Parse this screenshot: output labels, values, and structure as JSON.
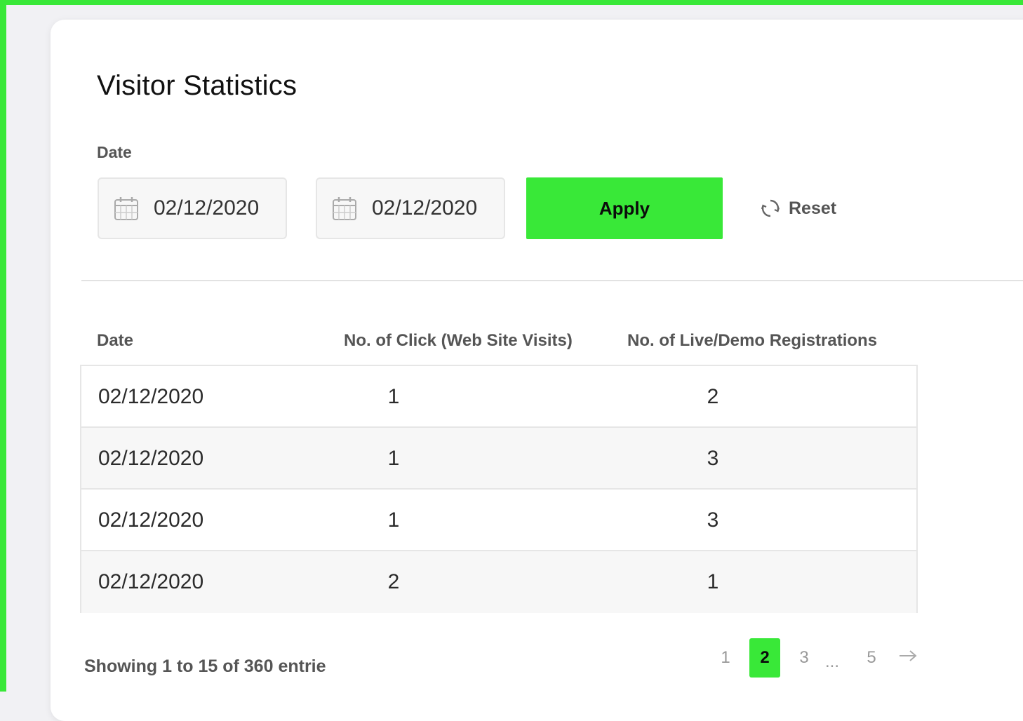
{
  "colors": {
    "accent": "#39e838",
    "frame": "#39e838",
    "text_muted": "#555555"
  },
  "page": {
    "title": "Visitor Statistics"
  },
  "filter": {
    "label": "Date",
    "start_date": "02/12/2020",
    "end_date": "02/12/2020",
    "calendar_icon": "calendar-icon",
    "apply_label": "Apply",
    "reset_label": "Reset",
    "reset_icon": "refresh-icon"
  },
  "table": {
    "headers": [
      "Date",
      "No. of Click (Web Site Visits)",
      "No. of Live/Demo Registrations"
    ],
    "rows": [
      [
        "02/12/2020",
        "1",
        "2"
      ],
      [
        "02/12/2020",
        "1",
        "3"
      ],
      [
        "02/12/2020",
        "1",
        "3"
      ],
      [
        "02/12/2020",
        "2",
        "1"
      ]
    ]
  },
  "pagination": {
    "info": "Showing 1 to 15 of 360 entrie",
    "pages": [
      "1",
      "2",
      "3",
      "5"
    ],
    "ellipsis": "...",
    "current": "2",
    "next_icon": "arrow-right-icon"
  }
}
